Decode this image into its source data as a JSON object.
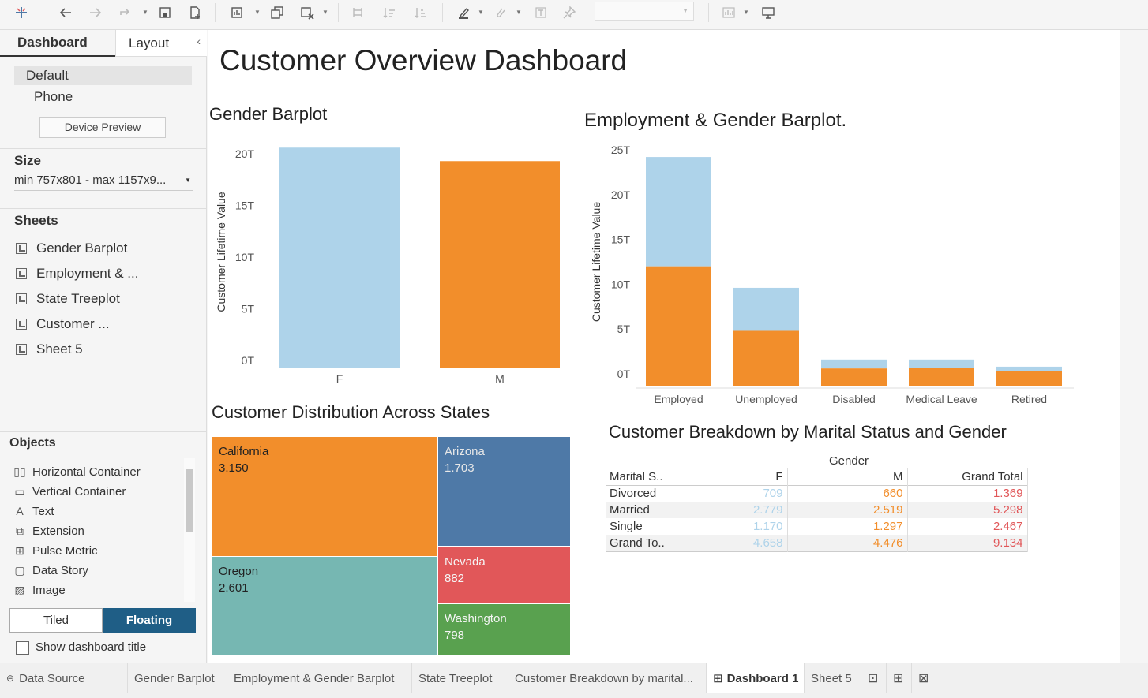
{
  "toolbar": {
    "icons": [
      "tableau-logo-icon",
      "undo-icon",
      "redo-icon",
      "replay-icon",
      "save-icon",
      "new-data-source-icon",
      "new-worksheet-icon",
      "duplicate-icon",
      "clear-sheet-icon",
      "swap-icon",
      "sort-ascending-icon",
      "sort-descending-icon",
      "highlight-icon",
      "group-icon",
      "labels-icon",
      "pin-icon",
      "fit-dropdown",
      "show-me-icon",
      "presentation-icon"
    ]
  },
  "sidebar": {
    "tabs": {
      "dashboard": "Dashboard",
      "layout": "Layout"
    },
    "devices": [
      "Default",
      "Phone"
    ],
    "device_preview": "Device Preview",
    "size_label": "Size",
    "size_value": "min 757x801 - max 1157x9...",
    "sheets_label": "Sheets",
    "sheets": [
      "Gender Barplot",
      "Employment & ...",
      "State Treeplot",
      "Customer ...",
      "Sheet 5"
    ],
    "objects_label": "Objects",
    "objects": [
      "Horizontal Container",
      "Vertical Container",
      "Text",
      "Extension",
      "Pulse Metric",
      "Data Story",
      "Image"
    ],
    "tiled": "Tiled",
    "floating": "Floating",
    "show_title": "Show dashboard title"
  },
  "dashboard": {
    "title": "Customer Overview Dashboard",
    "gender_title": "Gender Barplot",
    "employment_title": "Employment & Gender Barplot.",
    "treemap_title": "Customer Distribution Across States",
    "table_title": "Customer Breakdown by Marital Status and Gender"
  },
  "colors": {
    "female": "#aed3ea",
    "male": "#f28e2b",
    "teal": "#76b7b2",
    "blue": "#4e79a7",
    "red": "#e15759",
    "green": "#59a14f",
    "total_red": "#e15759"
  },
  "chart_data": [
    {
      "type": "bar",
      "title": "Gender Barplot",
      "categories": [
        "F",
        "M"
      ],
      "values": [
        20.6,
        19.3
      ],
      "ylabel": "Customer Lifetime Value",
      "yticks": [
        "0T",
        "5T",
        "10T",
        "15T",
        "20T"
      ],
      "ylim": [
        0,
        21
      ],
      "colors": [
        "#aed3ea",
        "#f28e2b"
      ]
    },
    {
      "type": "bar",
      "title": "Employment & Gender Barplot.",
      "categories": [
        "Employed",
        "Unemployed",
        "Disabled",
        "Medical Leave",
        "Retired"
      ],
      "series": [
        {
          "values": [
            12.0,
            4.8,
            0.6,
            0.7,
            0.35
          ]
        },
        {
          "values": [
            24.2,
            9.6,
            1.6,
            1.6,
            0.8
          ]
        }
      ],
      "ylabel": "Customer Lifetime Value",
      "yticks": [
        "0T",
        "5T",
        "10T",
        "15T",
        "20T",
        "25T"
      ],
      "ylim": [
        0,
        25
      ],
      "stacked": true
    },
    {
      "type": "heatmap",
      "title": "Customer Distribution Across States",
      "items": [
        {
          "name": "California",
          "value": "3.150"
        },
        {
          "name": "Arizona",
          "value": "1.703"
        },
        {
          "name": "Oregon",
          "value": "2.601"
        },
        {
          "name": "Nevada",
          "value": "882"
        },
        {
          "name": "Washington",
          "value": "798"
        }
      ]
    },
    {
      "type": "table",
      "title": "Customer Breakdown by Marital Status and Gender",
      "column_group": "Gender",
      "columns": [
        "Marital S..",
        "F",
        "M",
        "Grand Total"
      ],
      "rows": [
        [
          "Divorced",
          "709",
          "660",
          "1.369"
        ],
        [
          "Married",
          "2.779",
          "2.519",
          "5.298"
        ],
        [
          "Single",
          "1.170",
          "1.297",
          "2.467"
        ],
        [
          "Grand To..",
          "4.658",
          "4.476",
          "9.134"
        ]
      ]
    }
  ],
  "tabs": [
    "Data Source",
    "Gender Barplot",
    "Employment & Gender Barplot",
    "State Treeplot",
    "Customer Breakdown by marital...",
    "Dashboard 1",
    "Sheet 5"
  ]
}
